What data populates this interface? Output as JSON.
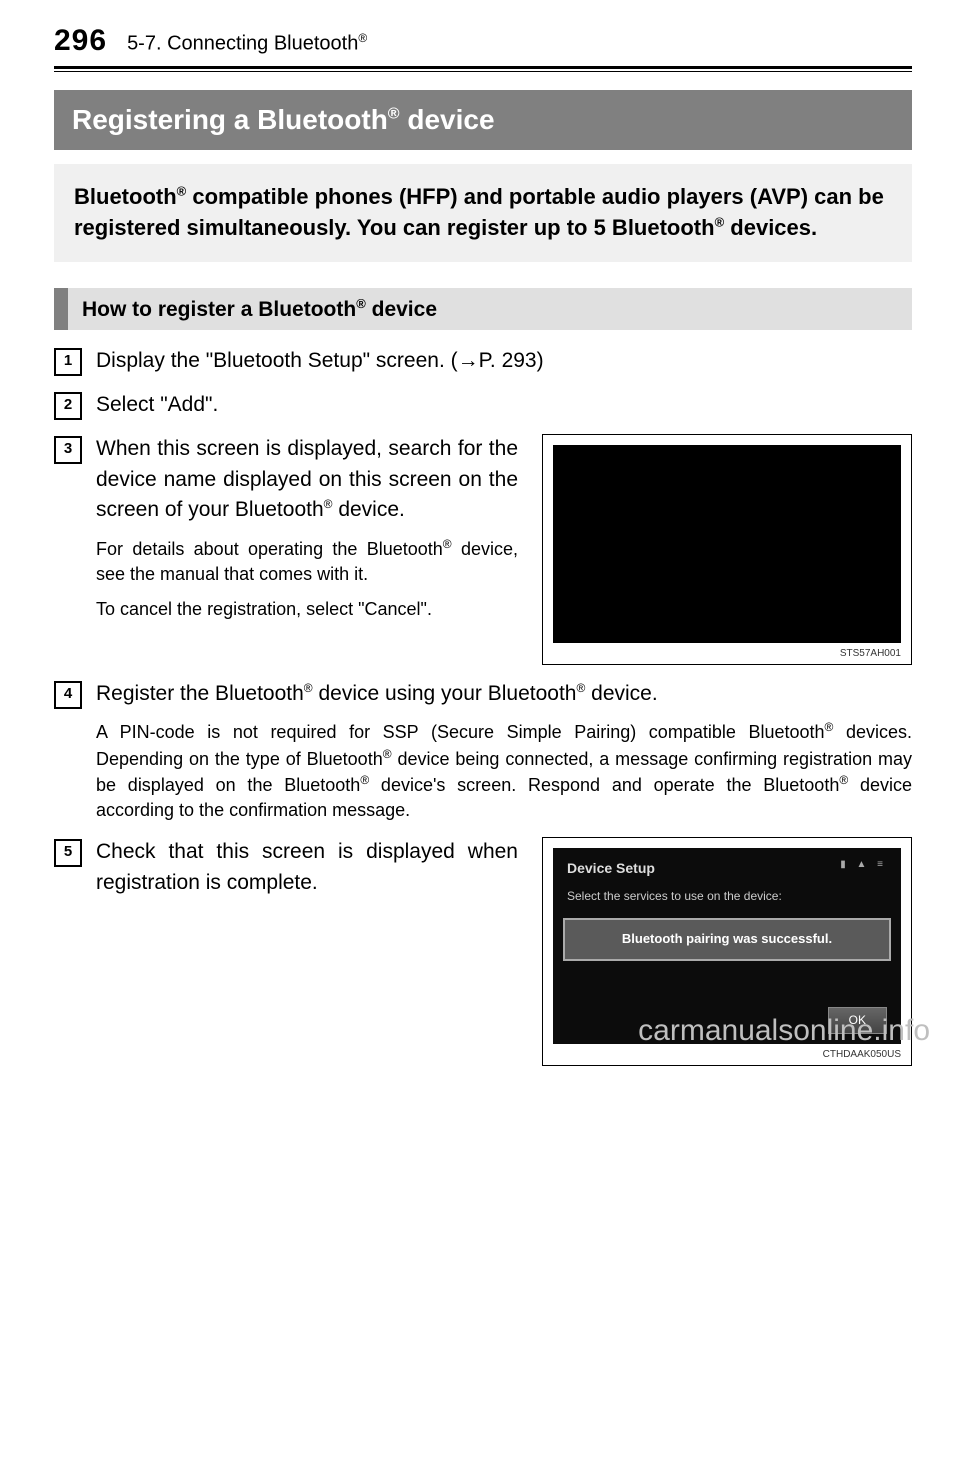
{
  "page_number": "296",
  "breadcrumb_prefix": "5-7. Connecting Bluetooth",
  "breadcrumb_sup": "®",
  "title_pre": "Registering a Bluetooth",
  "title_sup": "®",
  "title_post": " device",
  "intro": {
    "l1a": "Bluetooth",
    "l1sup": "®",
    "l1b": " compatible phones (HFP) and portable audio players (AVP) can be registered simultaneously. You can register up to 5 Bluetooth",
    "l2sup": "®",
    "l2b": " devices."
  },
  "section_header": {
    "pre": "How to register a Bluetooth",
    "sup": "®",
    "post": " device"
  },
  "steps": {
    "s1": {
      "num": "1",
      "text_a": "Display the \"Bluetooth Setup\" screen. (",
      "arrow": "→",
      "text_b": "P. 293)"
    },
    "s2": {
      "num": "2",
      "text": "Select \"Add\"."
    },
    "s3": {
      "num": "3",
      "p1a": "When this screen is displayed, search for the device name displayed on this screen on the screen of your Bluetooth",
      "p1sup": "®",
      "p1b": " device.",
      "p2a": "For details about operating the Bluetooth",
      "p2sup": "®",
      "p2b": " device, see the manual that comes with it.",
      "p3": "To cancel the registration, select \"Cancel\".",
      "fig_caption": "STS57AH001"
    },
    "s4": {
      "num": "4",
      "p1a": "Register the Bluetooth",
      "p1sup": "®",
      "p1b": " device using your Bluetooth",
      "p1sup2": "®",
      "p1c": " device.",
      "p2a": "A PIN-code is not required for SSP (Secure Simple Pairing) compatible Bluetooth",
      "p2sup": "®",
      "p2b": " devices. Depending on the type of Bluetooth",
      "p2sup2": "®",
      "p2c": " device being connected, a message confirming registration may be displayed on the Bluetooth",
      "p2sup3": "®",
      "p2d": " device's screen. Respond and operate the Bluetooth",
      "p2sup4": "®",
      "p2e": " device according to the confirmation message."
    },
    "s5": {
      "num": "5",
      "text": "Check that this screen is displayed when registration is complete.",
      "fig_caption": "CTHDAAK050US",
      "screen": {
        "title": "Device Setup",
        "subtitle": "Select the services to use on the device:",
        "dialog": "Bluetooth pairing was successful.",
        "ok": "OK"
      }
    }
  },
  "watermark": "carmanualsonline.info"
}
